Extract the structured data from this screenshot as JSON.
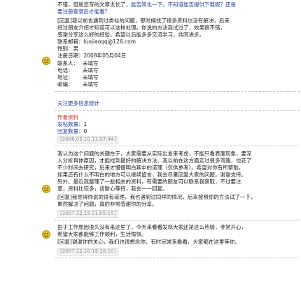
{
  "post1": {
    "intro_line1_black": "不错，但是您写的文章太长了，",
    "intro_line1_blue": "能否简化一下，不知道能否提供下载呢？",
    "intro_line1_tail": "还是",
    "intro_line2": "要注册登录后才能看？",
    "body_lines": [
      "[回复]我以前也遇到过类似的问题，那时候找了很多资料也没有解决，后来",
      "经过朋友介绍才知道可以这样处理。你说的方法我试过了，效果很不错，",
      "感谢分享这么好的经验，希望以后能多多交流学习，共同进步。",
      "联系邮箱：luojiaoqq@126.com"
    ],
    "meta": [
      {
        "label": "性别：",
        "value": "男"
      },
      {
        "label": "注册日期：",
        "value": "2008年05月04日"
      }
    ],
    "fields": [
      {
        "label": "联系人：",
        "value": "未填写"
      },
      {
        "label": "电话：",
        "value": "未填写"
      },
      {
        "label": "地址：",
        "value": "未填写"
      },
      {
        "label": "邮编：",
        "value": "未填写"
      }
    ]
  },
  "section_title": "关注更多信息统计",
  "stats": {
    "header": "作者资料",
    "posts_label": "发帖数量：",
    "posts_value": "1",
    "reply_label": "回复数量：",
    "reply_value": "0",
    "timestamp": "[2008.05.10 11:07:44]"
  },
  "post2": {
    "lines": [
      "我认为这个问题的关键在于，大家需要从实际出发来考虑，不能只看表面现象，要深",
      "入分析具体原因，才能找到最好的解决方法。我以前在这方面走过很多弯路，也花了",
      "不少时间去研究，后来才慢慢明白其中的道理（仅供参考）。希望对你有所帮助，",
      "如果还有什么不明白的地方可以继续留言，我会尽量回复大家的问题，谢谢支持。",
      "另外，最近我整理了一些相关的资料，有需要的朋友可以联系我获取，不过要注",
      "意，资料比较多，请耐心等待，我会一一回复。"
    ],
    "reply": "[回复]我觉得你说的很有道理，我也遇到过同样的情况，后来按照你的方法试了一下，",
    "reply2": "果然解决了问题，真的非常感谢你的分享。",
    "timestamp": "[2007.12.15 21:05:15]"
  },
  "post3": {
    "lines": [
      "由于工作原因很久没有来这里了，今天来看看发现大家还是这么热情，非常开心，",
      "希望大家都能够工作顺利，生活愉快。"
    ],
    "reply": "[回复]谢谢你的关心，我们也很想念你，有时间常来看看，大家都在这里等你。",
    "timestamp": "[2007.12.10 19:18:10]"
  }
}
